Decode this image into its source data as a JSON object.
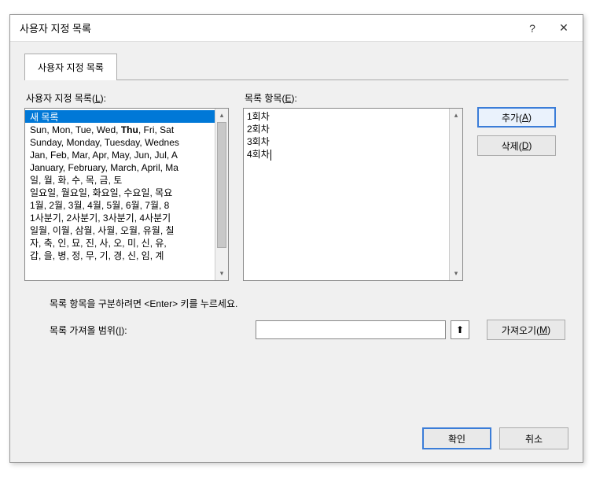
{
  "dialog": {
    "title": "사용자 지정 목록",
    "help_icon": "?",
    "close_icon": "✕"
  },
  "tabs": {
    "custom_lists": "사용자 지정 목록"
  },
  "labels": {
    "custom_lists_label": "사용자 지정 목록(L):",
    "list_entries_label": "목록 항목(E):",
    "hint": "목록 항목을 구분하려면 <Enter> 키를 누르세요.",
    "import_range_label": "목록 가져올 범위(I):"
  },
  "custom_lists": {
    "items": [
      "새 목록",
      "Sun, Mon, Tue, Wed, Thu, Fri, Sat",
      "Sunday, Monday, Tuesday, Wednes",
      "Jan, Feb, Mar, Apr, May, Jun, Jul, A",
      "January, February, March, April, Ma",
      "일, 월, 화, 수, 목, 금, 토",
      "일요일, 월요일, 화요일, 수요일, 목요",
      "1월, 2월, 3월, 4월, 5월, 6월, 7월, 8",
      "1사분기, 2사분기, 3사분기, 4사분기",
      "일월, 이월, 삼월, 사월, 오월, 유월, 칠",
      "자, 축, 인, 묘, 진, 사, 오, 미, 신, 유,",
      "갑, 을, 병, 정, 무, 기, 경, 신, 임, 계"
    ],
    "selected_index": 0
  },
  "list_entries": {
    "items": [
      "1회차",
      "2회차",
      "3회차",
      "4회차"
    ]
  },
  "buttons": {
    "add": "추가(A)",
    "delete": "삭제(D)",
    "import": "가져오기(M)",
    "ok": "확인",
    "cancel": "취소"
  },
  "import_range": {
    "value": ""
  }
}
